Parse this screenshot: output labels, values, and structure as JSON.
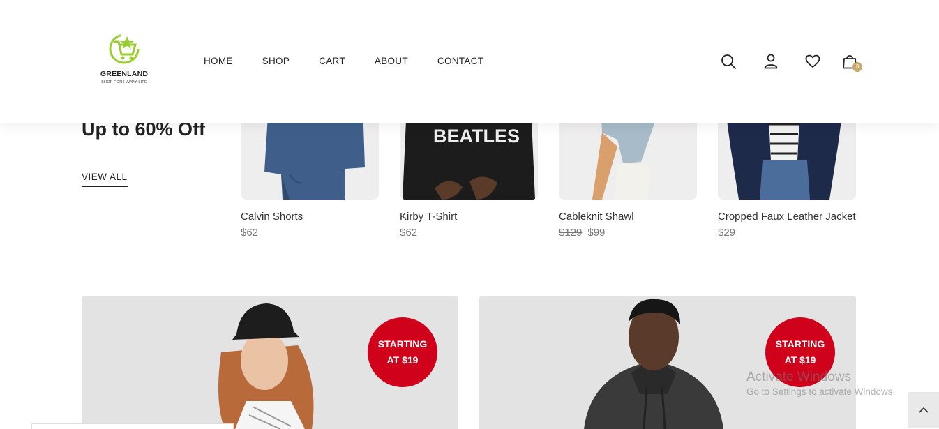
{
  "brand": {
    "name": "GREENLAND",
    "tagline": "SHOP FOR HAPPY LIFE"
  },
  "nav": {
    "items": [
      "HOME",
      "SHOP",
      "CART",
      "ABOUT",
      "CONTACT"
    ]
  },
  "header_icons": [
    "search-icon",
    "user-icon",
    "heart-icon",
    "shopping-bag-icon"
  ],
  "cart": {
    "count": "3"
  },
  "promo": {
    "title": "Up to 60% Off",
    "link": "VIEW ALL"
  },
  "products": [
    {
      "name": "Calvin Shorts",
      "price": "$62",
      "old_price": ""
    },
    {
      "name": "Kirby T-Shirt",
      "price": "$62",
      "old_price": "",
      "print": "BEATLES"
    },
    {
      "name": "Cableknit Shawl",
      "price": "$99",
      "old_price": "$129"
    },
    {
      "name": "Cropped Faux Leather Jacket",
      "price": "$29",
      "old_price": ""
    }
  ],
  "banners": [
    {
      "badge_line1": "STARTING",
      "badge_line2": "AT $19"
    },
    {
      "badge_line1": "STARTING",
      "badge_line2": "AT $19"
    }
  ],
  "os_overlay": {
    "title": "Activate Windows",
    "subtitle": "Go to Settings to activate Windows."
  },
  "colors": {
    "accent": "#d0021b",
    "badge": "#c9a96e",
    "logo": "#9acd32"
  }
}
